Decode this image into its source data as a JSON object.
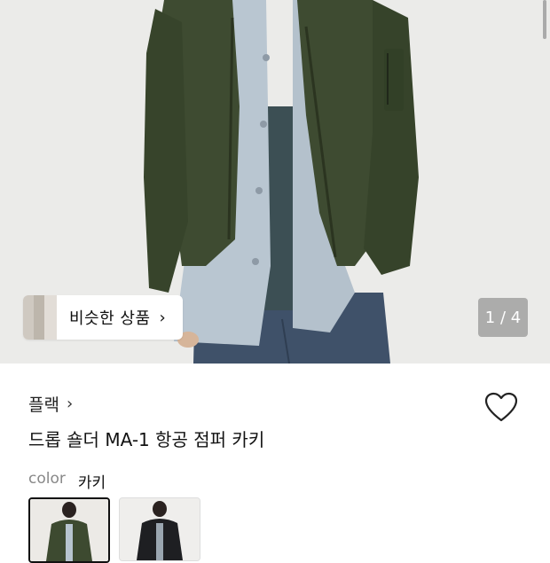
{
  "gallery": {
    "similar_label": "비슷한 상품",
    "counter": "1 / 4"
  },
  "product": {
    "brand": "플랙",
    "title": "드롭 숄더 MA-1 항공 점퍼 카키"
  },
  "options": {
    "color_label": "color",
    "color_value": "카키",
    "swatches": [
      "khaki",
      "black"
    ]
  },
  "colors": {
    "jacket_khaki": "#3d4a30",
    "shirt_blue": "#b7c4cf",
    "jeans": "#3d4f68"
  },
  "icons": {
    "wishlist": "heart-icon",
    "chevron": "chevron-right-icon"
  }
}
